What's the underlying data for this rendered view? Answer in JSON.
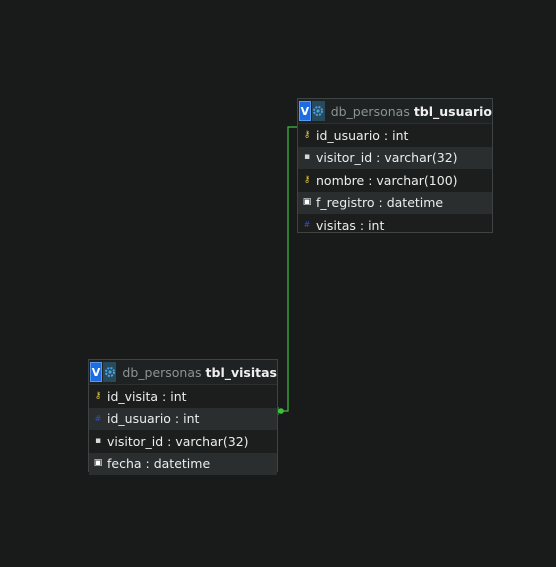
{
  "tables": [
    {
      "db": "db_personas",
      "name": "tbl_usuario",
      "columns": [
        {
          "text": "id_usuario : int",
          "icon": "primary-key-icon"
        },
        {
          "text": "visitor_id : varchar(32)",
          "icon": "text-field-icon"
        },
        {
          "text": "nombre : varchar(100)",
          "icon": "primary-key-icon"
        },
        {
          "text": "f_registro : datetime",
          "icon": "datetime-field-icon"
        },
        {
          "text": "visitas : int",
          "icon": "numeric-field-icon"
        }
      ]
    },
    {
      "db": "db_personas",
      "name": "tbl_visitas",
      "columns": [
        {
          "text": "id_visita : int",
          "icon": "primary-key-icon"
        },
        {
          "text": "id_usuario : int",
          "icon": "foreign-key-icon"
        },
        {
          "text": "visitor_id : varchar(32)",
          "icon": "text-field-icon"
        },
        {
          "text": "fecha : datetime",
          "icon": "datetime-field-icon"
        }
      ]
    }
  ],
  "header_buttons": {
    "view_label": "V",
    "options_icon": "gear-icon"
  },
  "colors": {
    "background": "#191b1b",
    "relation_line": "#3fbf3f",
    "view_button": "#1e6de0",
    "key_icon": "#e3c73a"
  }
}
